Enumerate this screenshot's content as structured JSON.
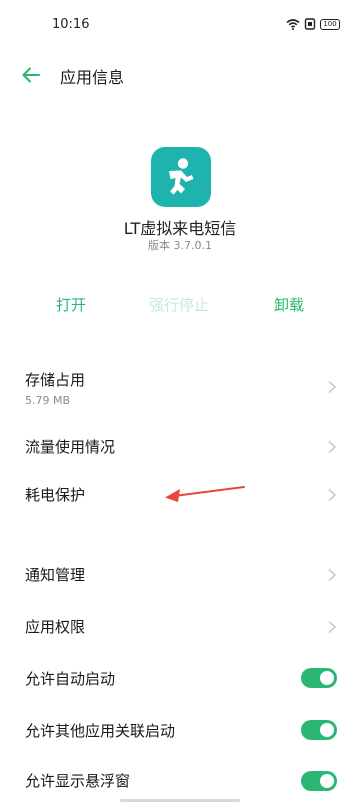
{
  "status_bar": {
    "time": "10:16",
    "battery_text": "100"
  },
  "header": {
    "title": "应用信息",
    "back_icon": "arrow-left-icon"
  },
  "app": {
    "icon": "aim-running-man-icon",
    "icon_color": "#1fb3ad",
    "name": "LT虚拟来电短信",
    "version": "版本 3.7.0.1"
  },
  "actions": {
    "open_label": "打开",
    "force_stop_label": "强行停止",
    "uninstall_label": "卸载"
  },
  "settings": {
    "storage": {
      "label": "存储占用",
      "value": "5.79 MB"
    },
    "data_usage": {
      "label": "流量使用情况"
    },
    "battery": {
      "label": "耗电保护"
    },
    "notifications": {
      "label": "通知管理"
    },
    "permissions": {
      "label": "应用权限"
    },
    "auto_start": {
      "label": "允许自动启动",
      "enabled": true
    },
    "associated_start": {
      "label": "允许其他应用关联启动",
      "enabled": true
    },
    "floating_window": {
      "label": "允许显示悬浮窗",
      "enabled": true
    }
  },
  "colors": {
    "accent": "#2bb673",
    "disabled_accent": "#c9e9d8",
    "annotation": "#e8453c"
  }
}
